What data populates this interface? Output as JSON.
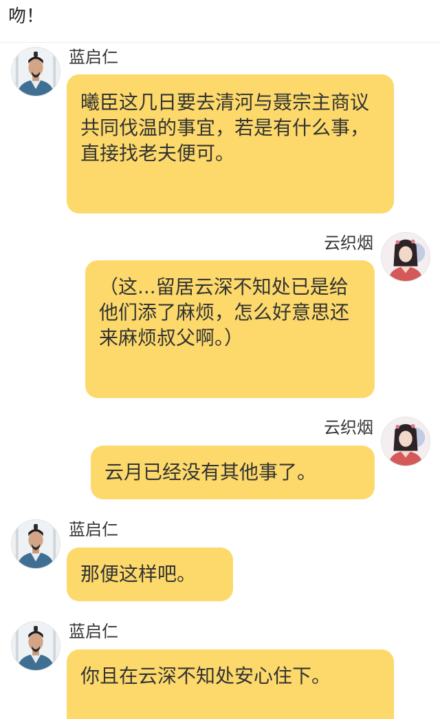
{
  "header": {
    "text": "吻！"
  },
  "messages": [
    {
      "side": "left",
      "sender": "蓝启仁",
      "avatar": "elder-man-avatar",
      "text": "曦臣这几日要去清河与聂宗主商议共同伐温的事宜，若是有什么事，直接找老夫便可。"
    },
    {
      "side": "right",
      "sender": "云织烟",
      "avatar": "young-woman-avatar",
      "text": "（这...留居云深不知处已是给他们添了麻烦，怎么好意思还来麻烦叔父啊。）"
    },
    {
      "side": "right",
      "sender": "云织烟",
      "avatar": "young-woman-avatar",
      "text": "云月已经没有其他事了。"
    },
    {
      "side": "left",
      "sender": "蓝启仁",
      "avatar": "elder-man-avatar",
      "text": "那便这样吧。"
    },
    {
      "side": "left",
      "sender": "蓝启仁",
      "avatar": "elder-man-avatar",
      "text": "你且在云深不知处安心住下。"
    }
  ],
  "colors": {
    "bubble": "#fcd96a",
    "background": "#ffffff",
    "text": "#333333"
  }
}
